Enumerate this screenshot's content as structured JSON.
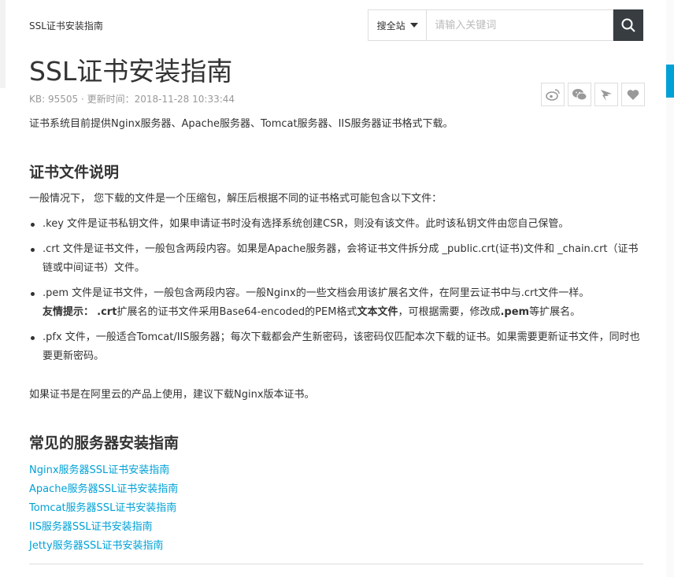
{
  "breadcrumb": "SSL证书安装指南",
  "search": {
    "scope": "搜全站",
    "placeholder": "请输入关键词",
    "icon": "search-icon"
  },
  "article": {
    "title": "SSL证书安装指南",
    "meta": "KB: 95505 · 更新时间：2018-11-28 10:33:44",
    "intro": "证书系统目前提供Nginx服务器、Apache服务器、Tomcat服务器、IIS服务器证书格式下载。",
    "section1": {
      "heading": "证书文件说明",
      "lead": "一般情况下， 您下载的文件是一个压缩包，解压后根据不同的证书格式可能包含以下文件：",
      "items": [
        {
          "text": ".key 文件是证书私钥文件，如果申请证书时没有选择系统创建CSR，则没有该文件。此时该私钥文件由您自己保管。"
        },
        {
          "text": ".crt 文件是证书文件，一般包含两段内容。如果是Apache服务器，会将证书文件拆分成 _public.crt(证书)文件和 _chain.crt（证书链或中间证书）文件。"
        },
        {
          "text": ".pem 文件是证书文件，一般包含两段内容。一般Nginx的一些文档会用该扩展名文件，在阿里云证书中与.crt文件一样。",
          "tip_label": "友情提示：",
          "tip_ext": ".crt",
          "tip_text1": "扩展名的证书文件采用Base64-encoded的PEM格式",
          "tip_bold": "文本文件",
          "tip_text2": "，可根据需要，修改成",
          "tip_ext2": ".pem",
          "tip_text3": "等扩展名。"
        },
        {
          "text": ".pfx 文件，一般适合Tomcat/IIS服务器；每次下载都会产生新密码，该密码仅匹配本次下载的证书。如果需要更新证书文件，同时也要更新密码。"
        }
      ]
    },
    "note": "如果证书是在阿里云的产品上使用，建议下载Nginx版本证书。",
    "section2": {
      "heading": "常见的服务器安装指南",
      "links": [
        "Nginx服务器SSL证书安装指南",
        "Apache服务器SSL证书安装指南",
        "Tomcat服务器SSL证书安装指南",
        "IIS服务器SSL证书安装指南",
        "Jetty服务器SSL证书安装指南"
      ]
    }
  },
  "share": [
    "weibo-icon",
    "wechat-icon",
    "dingtalk-icon",
    "like-icon"
  ],
  "colors": {
    "link": "#00a1d6",
    "search_button": "#373d41",
    "accent_strip": "#00a1d6"
  }
}
